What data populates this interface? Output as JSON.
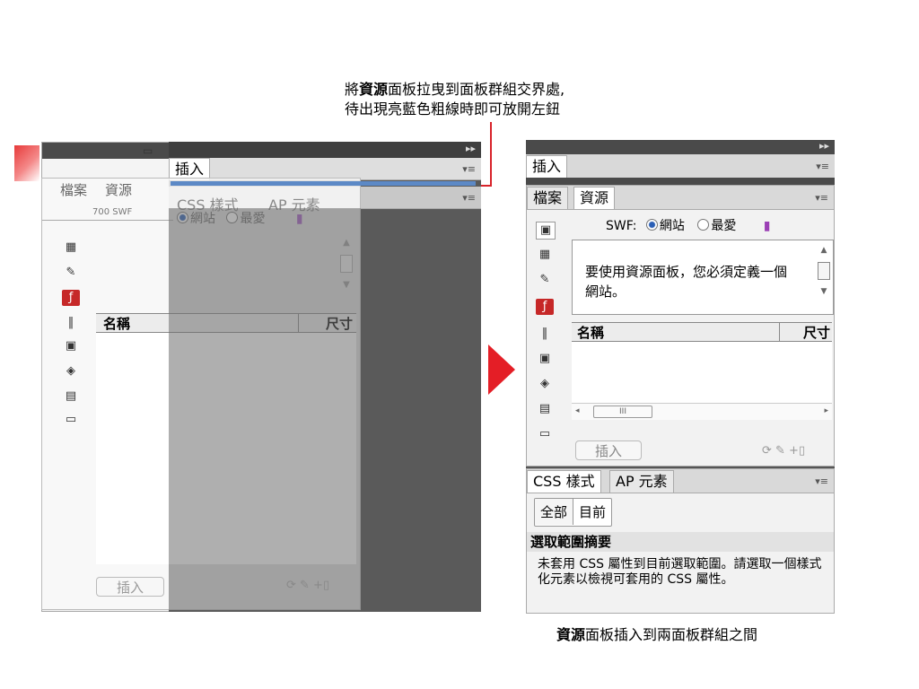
{
  "caption_top": {
    "line1_pre": "將",
    "line1_bold": "資源",
    "line1_post": "面板拉曳到面板群組交界處,",
    "line2": "待出現亮藍色粗線時即可放開左鈕"
  },
  "caption_bottom": {
    "bold": "資源",
    "rest": "面板插入到兩面板群組之間"
  },
  "left": {
    "tabs": [
      "檔案",
      "資源"
    ],
    "insert_tab": "插入",
    "css_tab": "CSS 樣式",
    "ap_tab": "AP 元素",
    "swf_label": "SWF",
    "radio_site": "網站",
    "radio_fav": "最愛",
    "col_name": "名稱",
    "col_size": "尺寸",
    "insert_button": "插入",
    "ruler": "700"
  },
  "right": {
    "insert_tab": "插入",
    "tabs": [
      "檔案",
      "資源"
    ],
    "swf_label": "SWF:",
    "radio_site": "網站",
    "radio_fav": "最愛",
    "message": "要使用資源面板，您必須定義一個網站。",
    "col_name": "名稱",
    "col_size": "尺寸",
    "scroll_label": "III",
    "insert_button": "插入",
    "css_tab": "CSS 樣式",
    "ap_tab": "AP 元素",
    "seg_all": "全部",
    "seg_current": "目前",
    "summary_title": "選取範圍摘要",
    "summary_text": "未套用 CSS 屬性到目前選取範圍。請選取一個樣式化元素以檢視可套用的 CSS 屬性。"
  },
  "colors": {
    "accent": "#e41e26",
    "blue_line": "#5c89c6",
    "header": "#4a4a4a"
  }
}
